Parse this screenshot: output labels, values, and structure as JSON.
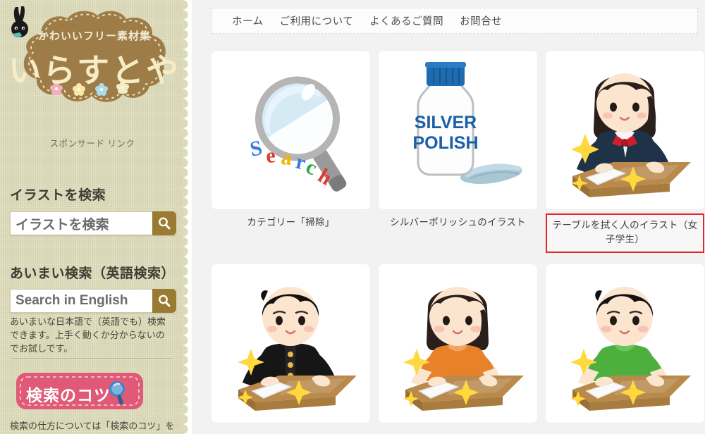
{
  "site": {
    "logo_sub": "かわいいフリー素材集",
    "logo_main": "いらすとや",
    "bunny_icon": "bunny-silhouette-icon"
  },
  "sidebar": {
    "sponsored_label": "スポンサード リンク",
    "search_jp": {
      "heading": "イラストを検索",
      "value": "イラストを検索",
      "placeholder": "イラストを検索",
      "button_icon": "search-icon"
    },
    "search_en": {
      "heading": "あいまい検索（英語検索）",
      "value": "Search in English",
      "placeholder": "Search in English",
      "button_icon": "search-icon",
      "note": "あいまいな日本語で（英語でも）検索できます。上手く動くか分からないのでお試しです。"
    },
    "tips": {
      "label": "検索のコツ",
      "icon": "magnifier-icon",
      "note": "検索の仕方については「検索のコツ」を"
    }
  },
  "nav": {
    "items": [
      {
        "label": "ホーム"
      },
      {
        "label": "ご利用について"
      },
      {
        "label": "よくあるご質問"
      },
      {
        "label": "お問合せ"
      }
    ]
  },
  "grid": {
    "cards": [
      {
        "caption": "カテゴリー「掃除」",
        "art": "magnifying-glass-search",
        "highlighted": false
      },
      {
        "caption": "シルバーポリッシュのイラスト",
        "art": "silver-polish-bottle",
        "bottle_line1": "SILVER",
        "bottle_line2": "POLISH",
        "highlighted": false
      },
      {
        "caption": "テーブルを拭く人のイラスト（女子学生）",
        "art": "person-wiping-table-schoolgirl",
        "highlighted": true
      },
      {
        "caption": "",
        "art": "person-wiping-table-schoolboy",
        "highlighted": false
      },
      {
        "caption": "",
        "art": "person-wiping-table-girl-orange",
        "highlighted": false
      },
      {
        "caption": "",
        "art": "person-wiping-table-boy-green",
        "highlighted": false
      }
    ]
  },
  "colors": {
    "sidebar_bg": "#dcdab7",
    "logo_badge": "#9d7c47",
    "logo_text": "#f6edc6",
    "search_button": "#9a7b32",
    "tips_button": "#e05a77",
    "highlight_border": "#e8262a",
    "page_bg": "#f2f2f2",
    "card_bg": "#ffffff"
  }
}
